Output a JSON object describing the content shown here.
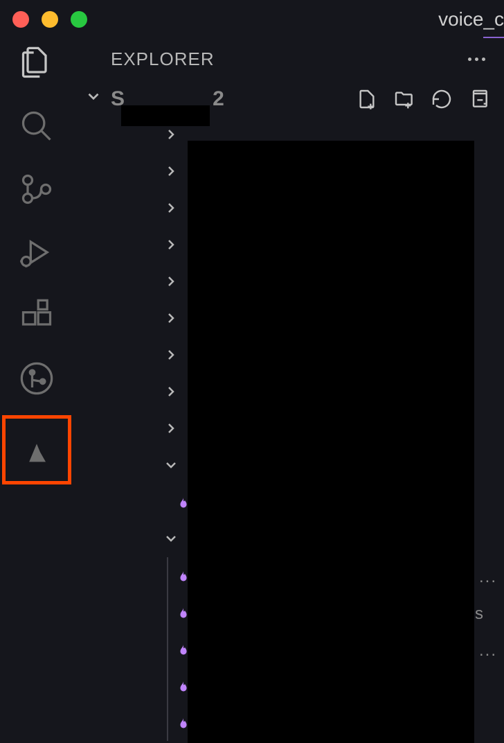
{
  "title_bar": {
    "filename": "voice_c"
  },
  "sidebar": {
    "title": "EXPLORER",
    "workspace_prefix": "S",
    "workspace_suffix": "2"
  },
  "colors": {
    "highlight_border": "#ff4500",
    "flame_icon": "#c084fc"
  },
  "tree": {
    "folders_collapsed": [
      {
        "depth": 1
      },
      {
        "depth": 1
      },
      {
        "depth": 1
      },
      {
        "depth": 1
      },
      {
        "depth": 1
      },
      {
        "depth": 1
      },
      {
        "depth": 1
      },
      {
        "depth": 1
      },
      {
        "depth": 1
      }
    ],
    "expanded1": {
      "depth": 1
    },
    "file1": {
      "icon": "flame"
    },
    "expanded2": {
      "depth": 1
    },
    "files_group2": [
      {
        "icon": "flame",
        "trailing": "..."
      },
      {
        "icon": "flame",
        "trailing": "s"
      },
      {
        "icon": "flame",
        "trailing": "..."
      },
      {
        "icon": "flame"
      },
      {
        "icon": "flame"
      }
    ]
  }
}
